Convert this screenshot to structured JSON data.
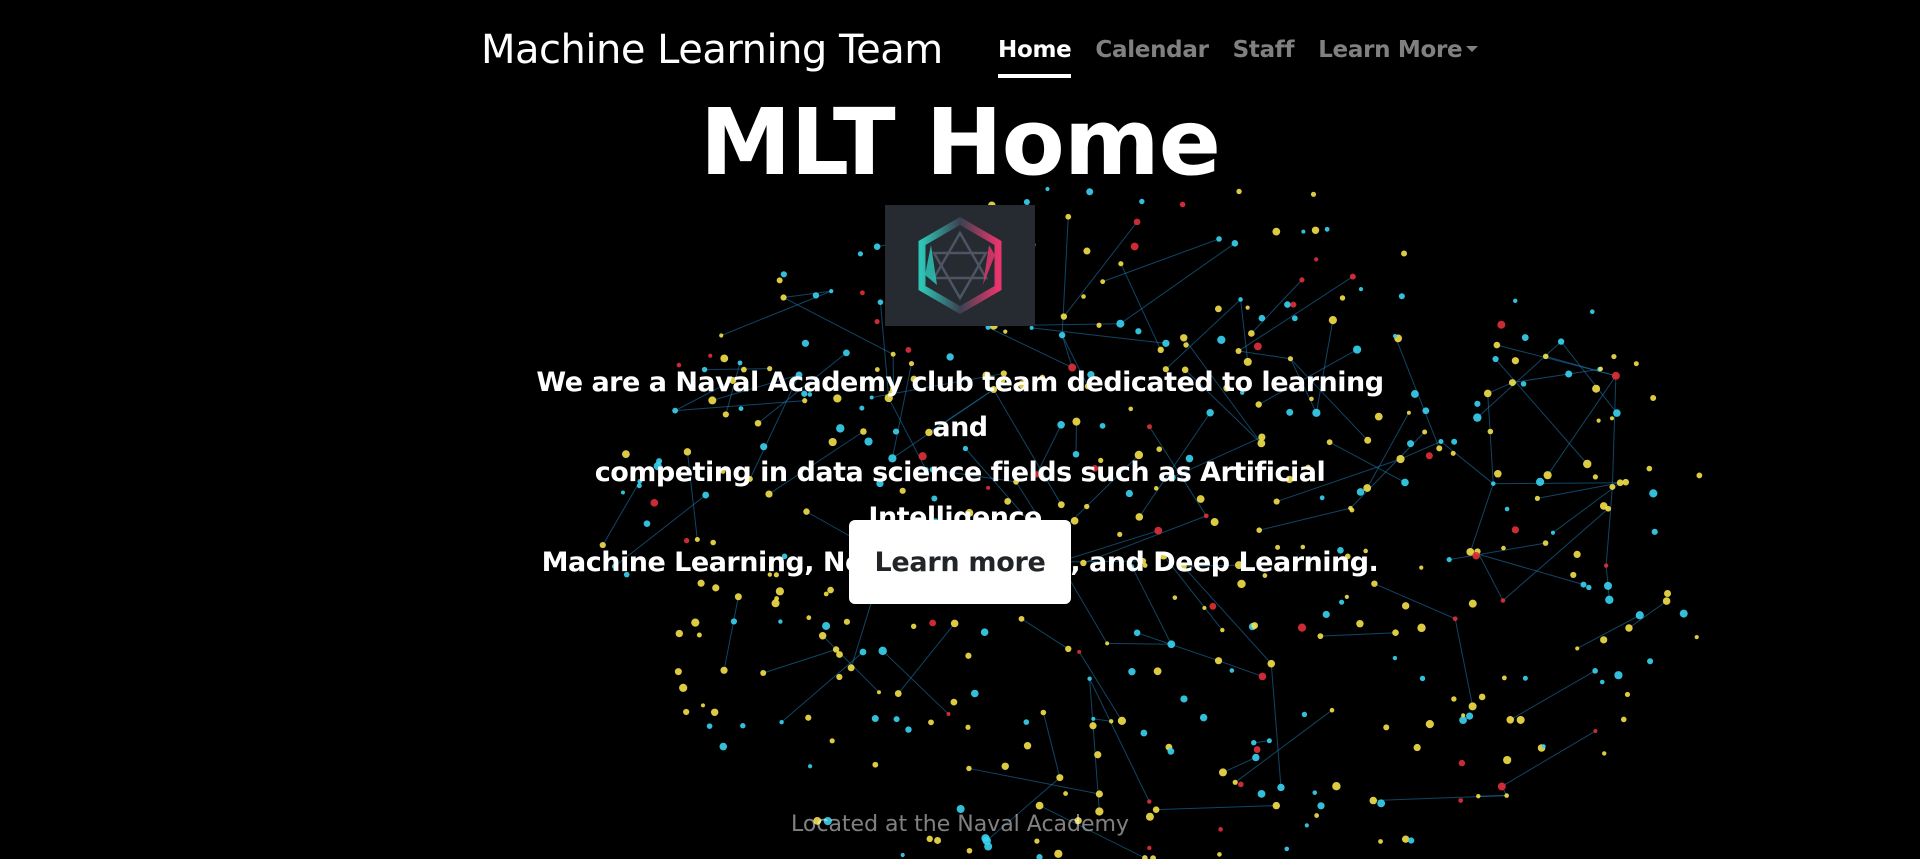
{
  "navbar": {
    "brand": "Machine Learning Team",
    "links": [
      {
        "label": "Home",
        "active": true
      },
      {
        "label": "Calendar",
        "active": false
      },
      {
        "label": "Staff",
        "active": false
      },
      {
        "label": "Learn More",
        "active": false,
        "dropdown": true
      }
    ]
  },
  "hero": {
    "title": "MLT Home",
    "logo_icon": "hexagon-star-logo",
    "lead_lines": [
      "We are a Naval Academy club team dedicated to learning and",
      "competing in data science fields such as Artificial Intelligence,",
      "Machine Learning, Neural Networks, and Deep Learning."
    ],
    "button_label": "Learn more"
  },
  "footer": {
    "text": "Located at the Naval Academy"
  },
  "colors": {
    "background": "#000000",
    "node_yellow": "#f5e04a",
    "node_cyan": "#39d4f2",
    "node_red": "#e0303a",
    "edge_blue": "#1e7fb8",
    "logo_teal": "#2ec4b6",
    "logo_pink": "#e8356d"
  }
}
